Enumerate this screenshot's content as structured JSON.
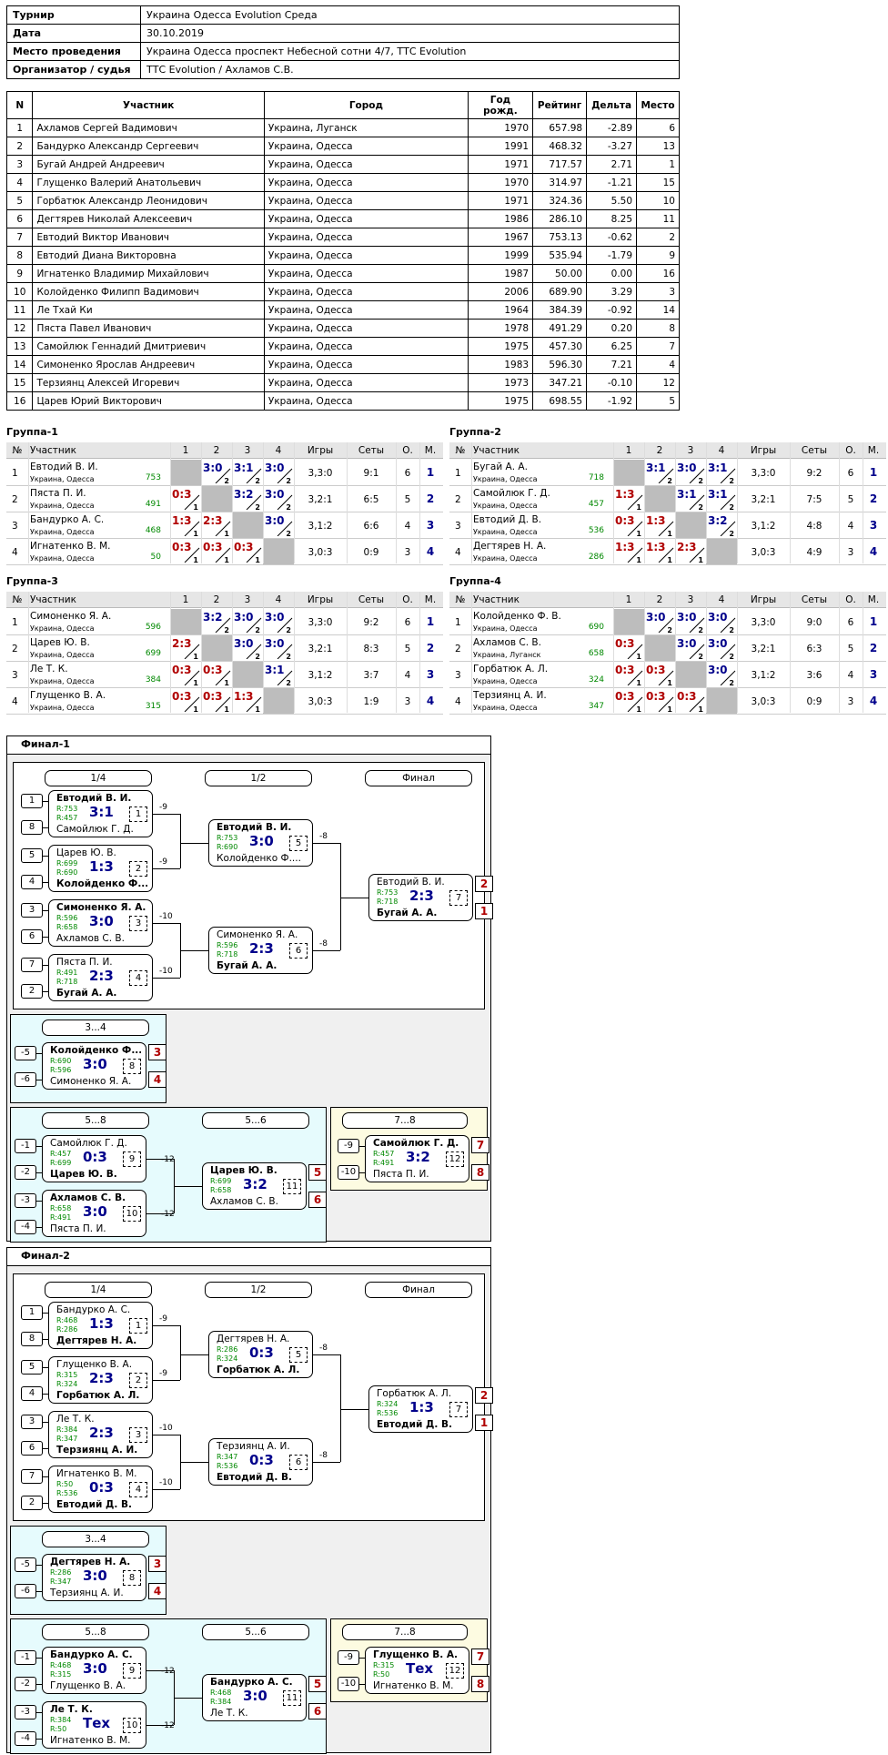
{
  "info": [
    [
      "Турнир",
      "Украина Одесса Evolution Среда"
    ],
    [
      "Дата",
      "30.10.2019"
    ],
    [
      "Место проведения",
      "Украина Одесса проспект Небесной сотни 4/7, ТТС Evolution"
    ],
    [
      "Организатор / судья",
      "ТТС Evolution / Ахламов С.В."
    ]
  ],
  "participants": {
    "headers": [
      "N",
      "Участник",
      "Город",
      "Год рожд.",
      "Рейтинг",
      "Дельта",
      "Место"
    ],
    "rows": [
      [
        "1",
        "Ахламов Сергей Вадимович",
        "Украина, Луганск",
        "1970",
        "657.98",
        "-2.89",
        "6"
      ],
      [
        "2",
        "Бандурко Александр Сергеевич",
        "Украина, Одесса",
        "1991",
        "468.32",
        "-3.27",
        "13"
      ],
      [
        "3",
        "Бугай Андрей Андреевич",
        "Украина, Одесса",
        "1971",
        "717.57",
        "2.71",
        "1"
      ],
      [
        "4",
        "Глущенко Валерий Анатольевич",
        "Украина, Одесса",
        "1970",
        "314.97",
        "-1.21",
        "15"
      ],
      [
        "5",
        "Горбатюк Александр Леонидович",
        "Украина, Одесса",
        "1971",
        "324.36",
        "5.50",
        "10"
      ],
      [
        "6",
        "Дегтярев Николай Алексеевич",
        "Украина, Одесса",
        "1986",
        "286.10",
        "8.25",
        "11"
      ],
      [
        "7",
        "Евтодий Виктор Иванович",
        "Украина, Одесса",
        "1967",
        "753.13",
        "-0.62",
        "2"
      ],
      [
        "8",
        "Евтодий Диана Викторовна",
        "Украина, Одесса",
        "1999",
        "535.94",
        "-1.79",
        "9"
      ],
      [
        "9",
        "Игнатенко Владимир Михайлович",
        "Украина, Одесса",
        "1987",
        "50.00",
        "0.00",
        "16"
      ],
      [
        "10",
        "Колойденко Филипп Вадимович",
        "Украина, Одесса",
        "2006",
        "689.90",
        "3.29",
        "3"
      ],
      [
        "11",
        "Ле Тхай Ки",
        "Украина, Одесса",
        "1964",
        "384.39",
        "-0.92",
        "14"
      ],
      [
        "12",
        "Пяста Павел Иванович",
        "Украина, Одесса",
        "1978",
        "491.29",
        "0.20",
        "8"
      ],
      [
        "13",
        "Самойлюк Геннадий Дмитриевич",
        "Украина, Одесса",
        "1975",
        "457.30",
        "6.25",
        "7"
      ],
      [
        "14",
        "Симоненко Ярослав Андреевич",
        "Украина, Одесса",
        "1983",
        "596.30",
        "7.21",
        "4"
      ],
      [
        "15",
        "Терзиянц Алексей Игоревич",
        "Украина, Одесса",
        "1973",
        "347.21",
        "-0.10",
        "12"
      ],
      [
        "16",
        "Царев Юрий Викторович",
        "Украина, Одесса",
        "1975",
        "698.55",
        "-1.92",
        "5"
      ]
    ]
  },
  "group_headers": [
    "№",
    "Участник",
    "1",
    "2",
    "3",
    "4",
    "Игры",
    "Сеты",
    "О.",
    "М."
  ],
  "groups": [
    {
      "title": "Группа-1",
      "rows": [
        {
          "n": "1",
          "name": "Евтодий В. И.",
          "city": "Украина, Одесса",
          "rating": "753",
          "cells": [
            "self",
            [
              "3:0",
              "2"
            ],
            [
              "3:1",
              "2"
            ],
            [
              "3:0",
              "2"
            ]
          ],
          "games": "3,3:0",
          "sets": "9:1",
          "pts": "6",
          "place": "1"
        },
        {
          "n": "2",
          "name": "Пяста П. И.",
          "city": "Украина, Одесса",
          "rating": "491",
          "cells": [
            [
              "0:3",
              "1"
            ],
            "self",
            [
              "3:2",
              "2"
            ],
            [
              "3:0",
              "2"
            ]
          ],
          "games": "3,2:1",
          "sets": "6:5",
          "pts": "5",
          "place": "2"
        },
        {
          "n": "3",
          "name": "Бандурко А. С.",
          "city": "Украина, Одесса",
          "rating": "468",
          "cells": [
            [
              "1:3",
              "1"
            ],
            [
              "2:3",
              "1"
            ],
            "self",
            [
              "3:0",
              "2"
            ]
          ],
          "games": "3,1:2",
          "sets": "6:6",
          "pts": "4",
          "place": "3"
        },
        {
          "n": "4",
          "name": "Игнатенко В. М.",
          "city": "Украина, Одесса",
          "rating": "50",
          "cells": [
            [
              "0:3",
              "1"
            ],
            [
              "0:3",
              "1"
            ],
            [
              "0:3",
              "1"
            ],
            "self"
          ],
          "games": "3,0:3",
          "sets": "0:9",
          "pts": "3",
          "place": "4"
        }
      ]
    },
    {
      "title": "Группа-2",
      "rows": [
        {
          "n": "1",
          "name": "Бугай А. А.",
          "city": "Украина, Одесса",
          "rating": "718",
          "cells": [
            "self",
            [
              "3:1",
              "2"
            ],
            [
              "3:0",
              "2"
            ],
            [
              "3:1",
              "2"
            ]
          ],
          "games": "3,3:0",
          "sets": "9:2",
          "pts": "6",
          "place": "1"
        },
        {
          "n": "2",
          "name": "Самойлюк Г. Д.",
          "city": "Украина, Одесса",
          "rating": "457",
          "cells": [
            [
              "1:3",
              "1"
            ],
            "self",
            [
              "3:1",
              "2"
            ],
            [
              "3:1",
              "2"
            ]
          ],
          "games": "3,2:1",
          "sets": "7:5",
          "pts": "5",
          "place": "2"
        },
        {
          "n": "3",
          "name": "Евтодий Д. В.",
          "city": "Украина, Одесса",
          "rating": "536",
          "cells": [
            [
              "0:3",
              "1"
            ],
            [
              "1:3",
              "1"
            ],
            "self",
            [
              "3:2",
              "2"
            ]
          ],
          "games": "3,1:2",
          "sets": "4:8",
          "pts": "4",
          "place": "3"
        },
        {
          "n": "4",
          "name": "Дегтярев Н. А.",
          "city": "Украина, Одесса",
          "rating": "286",
          "cells": [
            [
              "1:3",
              "1"
            ],
            [
              "1:3",
              "1"
            ],
            [
              "2:3",
              "1"
            ],
            "self"
          ],
          "games": "3,0:3",
          "sets": "4:9",
          "pts": "3",
          "place": "4"
        }
      ]
    },
    {
      "title": "Группа-3",
      "rows": [
        {
          "n": "1",
          "name": "Симоненко Я. А.",
          "city": "Украина, Одесса",
          "rating": "596",
          "cells": [
            "self",
            [
              "3:2",
              "2"
            ],
            [
              "3:0",
              "2"
            ],
            [
              "3:0",
              "2"
            ]
          ],
          "games": "3,3:0",
          "sets": "9:2",
          "pts": "6",
          "place": "1"
        },
        {
          "n": "2",
          "name": "Царев Ю. В.",
          "city": "Украина, Одесса",
          "rating": "699",
          "cells": [
            [
              "2:3",
              "1"
            ],
            "self",
            [
              "3:0",
              "2"
            ],
            [
              "3:0",
              "2"
            ]
          ],
          "games": "3,2:1",
          "sets": "8:3",
          "pts": "5",
          "place": "2"
        },
        {
          "n": "3",
          "name": "Ле Т. К.",
          "city": "Украина, Одесса",
          "rating": "384",
          "cells": [
            [
              "0:3",
              "1"
            ],
            [
              "0:3",
              "1"
            ],
            "self",
            [
              "3:1",
              "2"
            ]
          ],
          "games": "3,1:2",
          "sets": "3:7",
          "pts": "4",
          "place": "3"
        },
        {
          "n": "4",
          "name": "Глущенко В. А.",
          "city": "Украина, Одесса",
          "rating": "315",
          "cells": [
            [
              "0:3",
              "1"
            ],
            [
              "0:3",
              "1"
            ],
            [
              "1:3",
              "1"
            ],
            "self"
          ],
          "games": "3,0:3",
          "sets": "1:9",
          "pts": "3",
          "place": "4"
        }
      ]
    },
    {
      "title": "Группа-4",
      "rows": [
        {
          "n": "1",
          "name": "Колойденко Ф. В.",
          "city": "Украина, Одесса",
          "rating": "690",
          "cells": [
            "self",
            [
              "3:0",
              "2"
            ],
            [
              "3:0",
              "2"
            ],
            [
              "3:0",
              "2"
            ]
          ],
          "games": "3,3:0",
          "sets": "9:0",
          "pts": "6",
          "place": "1"
        },
        {
          "n": "2",
          "name": "Ахламов С. В.",
          "city": "Украина, Луганск",
          "rating": "658",
          "cells": [
            [
              "0:3",
              "1"
            ],
            "self",
            [
              "3:0",
              "2"
            ],
            [
              "3:0",
              "2"
            ]
          ],
          "games": "3,2:1",
          "sets": "6:3",
          "pts": "5",
          "place": "2"
        },
        {
          "n": "3",
          "name": "Горбатюк А. Л.",
          "city": "Украина, Одесса",
          "rating": "324",
          "cells": [
            [
              "0:3",
              "1"
            ],
            [
              "0:3",
              "1"
            ],
            "self",
            [
              "3:0",
              "2"
            ]
          ],
          "games": "3,1:2",
          "sets": "3:6",
          "pts": "4",
          "place": "3"
        },
        {
          "n": "4",
          "name": "Терзиянц А. И.",
          "city": "Украина, Одесса",
          "rating": "347",
          "cells": [
            [
              "0:3",
              "1"
            ],
            [
              "0:3",
              "1"
            ],
            [
              "0:3",
              "1"
            ],
            "self"
          ],
          "games": "3,0:3",
          "sets": "0:9",
          "pts": "3",
          "place": "4"
        }
      ]
    }
  ],
  "finals": [
    {
      "title": "Финал-1",
      "rounds": [
        "1/4",
        "1/2",
        "Финал",
        "3...4",
        "5...8",
        "5...6",
        "7...8"
      ],
      "matches": [
        {
          "p1": "Евтодий В. И.",
          "p2": "Самойлюк Г. Д.",
          "b": 1,
          "r1": "R:753",
          "r2": "R:457",
          "score": "3:1",
          "no": "1",
          "s1": "1",
          "s2": "8"
        },
        {
          "p1": "Царев Ю. В.",
          "p2": "Колойденко Ф....",
          "b": 2,
          "r1": "R:699",
          "r2": "R:690",
          "score": "1:3",
          "no": "2",
          "s1": "5",
          "s2": "4"
        },
        {
          "p1": "Симоненко Я. А.",
          "p2": "Ахламов С. В.",
          "b": 1,
          "r1": "R:596",
          "r2": "R:658",
          "score": "3:0",
          "no": "3",
          "s1": "3",
          "s2": "6"
        },
        {
          "p1": "Пяста П. И.",
          "p2": "Бугай А. А.",
          "b": 2,
          "r1": "R:491",
          "r2": "R:718",
          "score": "2:3",
          "no": "4",
          "s1": "7",
          "s2": "2"
        },
        {
          "p1": "Евтодий В. И.",
          "p2": "Колойденко Ф....",
          "b": 1,
          "r1": "R:753",
          "r2": "R:690",
          "score": "3:0",
          "no": "5",
          "l1": "-9",
          "l2": "-9"
        },
        {
          "p1": "Симоненко Я. А.",
          "p2": "Бугай А. А.",
          "b": 2,
          "r1": "R:596",
          "r2": "R:718",
          "score": "2:3",
          "no": "6",
          "l1": "-10",
          "l2": "-10"
        },
        {
          "p1": "Евтодий В. И.",
          "p2": "Бугай А. А.",
          "b": 2,
          "r1": "R:753",
          "r2": "R:718",
          "score": "2:3",
          "no": "7",
          "l1": "-8",
          "l2": "-8",
          "pl1": "2",
          "pl2": "1"
        },
        {
          "p1": "Колойденко Ф....",
          "p2": "Симоненко Я. А.",
          "b": 1,
          "r1": "R:690",
          "r2": "R:596",
          "score": "3:0",
          "no": "8",
          "s1": "-5",
          "s2": "-6",
          "pl1": "3",
          "pl2": "4"
        },
        {
          "p1": "Самойлюк Г. Д.",
          "p2": "Царев Ю. В.",
          "b": 2,
          "r1": "R:457",
          "r2": "R:699",
          "score": "0:3",
          "no": "9",
          "s1": "-1",
          "s2": "-2",
          "o": "-12"
        },
        {
          "p1": "Ахламов С. В.",
          "p2": "Пяста П. И.",
          "b": 1,
          "r1": "R:658",
          "r2": "R:491",
          "score": "3:0",
          "no": "10",
          "s1": "-3",
          "s2": "-4",
          "o": "-12"
        },
        {
          "p1": "Царев Ю. В.",
          "p2": "Ахламов С. В.",
          "b": 1,
          "r1": "R:699",
          "r2": "R:658",
          "score": "3:2",
          "no": "11",
          "pl1": "5",
          "pl2": "6"
        },
        {
          "p1": "Самойлюк Г. Д.",
          "p2": "Пяста П. И.",
          "b": 1,
          "r1": "R:457",
          "r2": "R:491",
          "score": "3:2",
          "no": "12",
          "s1": "-9",
          "s2": "-10",
          "pl1": "7",
          "pl2": "8"
        }
      ]
    },
    {
      "title": "Финал-2",
      "rounds": [
        "1/4",
        "1/2",
        "Финал",
        "3...4",
        "5...8",
        "5...6",
        "7...8"
      ],
      "matches": [
        {
          "p1": "Бандурко А. С.",
          "p2": "Дегтярев Н. А.",
          "b": 2,
          "r1": "R:468",
          "r2": "R:286",
          "score": "1:3",
          "no": "1",
          "s1": "1",
          "s2": "8"
        },
        {
          "p1": "Глущенко В. А.",
          "p2": "Горбатюк А. Л.",
          "b": 2,
          "r1": "R:315",
          "r2": "R:324",
          "score": "2:3",
          "no": "2",
          "s1": "5",
          "s2": "4"
        },
        {
          "p1": "Ле Т. К.",
          "p2": "Терзиянц А. И.",
          "b": 2,
          "r1": "R:384",
          "r2": "R:347",
          "score": "2:3",
          "no": "3",
          "s1": "3",
          "s2": "6"
        },
        {
          "p1": "Игнатенко В. М.",
          "p2": "Евтодий Д. В.",
          "b": 2,
          "r1": "R:50",
          "r2": "R:536",
          "score": "0:3",
          "no": "4",
          "s1": "7",
          "s2": "2"
        },
        {
          "p1": "Дегтярев Н. А.",
          "p2": "Горбатюк А. Л.",
          "b": 2,
          "r1": "R:286",
          "r2": "R:324",
          "score": "0:3",
          "no": "5",
          "l1": "-9",
          "l2": "-9"
        },
        {
          "p1": "Терзиянц А. И.",
          "p2": "Евтодий Д. В.",
          "b": 2,
          "r1": "R:347",
          "r2": "R:536",
          "score": "0:3",
          "no": "6",
          "l1": "-10",
          "l2": "-10"
        },
        {
          "p1": "Горбатюк А. Л.",
          "p2": "Евтодий Д. В.",
          "b": 2,
          "r1": "R:324",
          "r2": "R:536",
          "score": "1:3",
          "no": "7",
          "l1": "-8",
          "l2": "-8",
          "pl1": "2",
          "pl2": "1"
        },
        {
          "p1": "Дегтярев Н. А.",
          "p2": "Терзиянц А. И.",
          "b": 1,
          "r1": "R:286",
          "r2": "R:347",
          "score": "3:0",
          "no": "8",
          "s1": "-5",
          "s2": "-6",
          "pl1": "3",
          "pl2": "4"
        },
        {
          "p1": "Бандурко А. С.",
          "p2": "Глущенко В. А.",
          "b": 1,
          "r1": "R:468",
          "r2": "R:315",
          "score": "3:0",
          "no": "9",
          "s1": "-1",
          "s2": "-2",
          "o": "-12"
        },
        {
          "p1": "Ле Т. К.",
          "p2": "Игнатенко В. М.",
          "b": 1,
          "r1": "R:384",
          "r2": "R:50",
          "score": "Тех",
          "no": "10",
          "s1": "-3",
          "s2": "-4",
          "o": "-12"
        },
        {
          "p1": "Бандурко А. С.",
          "p2": "Ле Т. К.",
          "b": 1,
          "r1": "R:468",
          "r2": "R:384",
          "score": "3:0",
          "no": "11",
          "pl1": "5",
          "pl2": "6"
        },
        {
          "p1": "Глущенко В. А.",
          "p2": "Игнатенко В. М.",
          "b": 1,
          "r1": "R:315",
          "r2": "R:50",
          "score": "Тех",
          "no": "12",
          "s1": "-9",
          "s2": "-10",
          "pl1": "7",
          "pl2": "8"
        }
      ]
    }
  ]
}
